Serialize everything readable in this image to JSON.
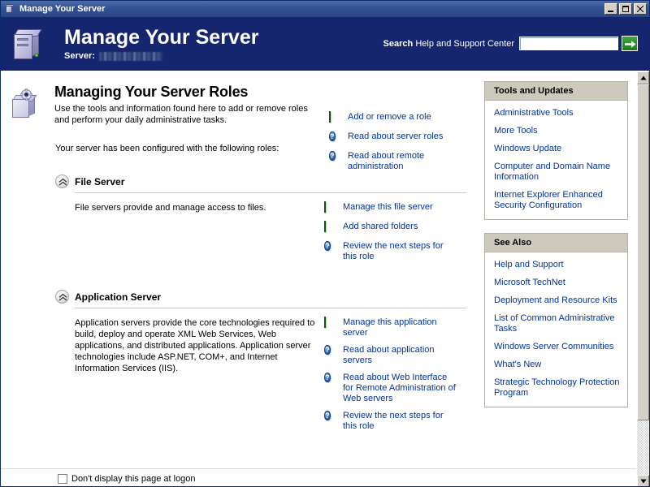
{
  "window": {
    "title": "Manage Your Server",
    "title_icon": "server-icon",
    "controls": {
      "minimize": "minimize-button",
      "maximize": "maximize-button",
      "close": "close-button"
    }
  },
  "header": {
    "icon": "server-tower-icon",
    "title": "Manage Your Server",
    "server_label": "Server:",
    "server_value": "",
    "search": {
      "label_bold": "Search",
      "label_rest": "Help and Support Center",
      "value": "",
      "placeholder": "",
      "go_icon": "arrow-right-icon",
      "go_label": "Go"
    }
  },
  "intro": {
    "icon": "server-gear-icon",
    "heading": "Managing Your Server Roles",
    "description": "Use the tools and information found here to add or remove roles and perform your daily administrative tasks.",
    "links": [
      {
        "icon": "green-arrow-icon",
        "label": "Add or remove a role"
      },
      {
        "icon": "help-icon",
        "label": "Read about server roles"
      },
      {
        "icon": "help-icon",
        "label": "Read about remote administration"
      }
    ],
    "configured_note": "Your server has been configured with the following roles:"
  },
  "roles": [
    {
      "collapse_icon": "chevron-up-icon",
      "title": "File Server",
      "description": "File servers provide and manage access to files.",
      "links": [
        {
          "icon": "green-arrow-icon",
          "label": "Manage this file server"
        },
        {
          "icon": "green-arrow-icon",
          "label": "Add shared folders"
        },
        {
          "icon": "help-icon",
          "label": "Review the next steps for this role"
        }
      ]
    },
    {
      "collapse_icon": "chevron-up-icon",
      "title": "Application Server",
      "description": "Application servers provide the core technologies required to build, deploy and operate XML Web Services, Web applications, and distributed applications. Application server technologies include ASP.NET, COM+, and Internet Information Services (IIS).",
      "links": [
        {
          "icon": "green-arrow-icon",
          "label": "Manage this application server"
        },
        {
          "icon": "help-icon",
          "label": "Read about application servers"
        },
        {
          "icon": "help-icon",
          "label": "Read about Web Interface for Remote Administration of Web servers"
        },
        {
          "icon": "help-icon",
          "label": "Review the next steps for this role"
        }
      ]
    }
  ],
  "sidebar": {
    "panels": [
      {
        "title": "Tools and Updates",
        "links": [
          "Administrative Tools",
          "More Tools",
          "Windows Update",
          "Computer and Domain Name Information",
          "Internet Explorer Enhanced Security Configuration"
        ]
      },
      {
        "title": "See Also",
        "links": [
          "Help and Support",
          "Microsoft TechNet",
          "Deployment and Resource Kits",
          "List of Common Administrative Tasks",
          "Windows Server Communities",
          "What's New",
          "Strategic Technology Protection Program"
        ]
      }
    ]
  },
  "footer": {
    "checkbox_label": "Don't display this page at logon",
    "checked": false
  },
  "scrollbar": {
    "up_icon": "triangle-up-icon",
    "down_icon": "triangle-down-icon"
  },
  "colors": {
    "titlebar": "#335292",
    "header_banner": "#16266e",
    "link": "#00339c",
    "panel_header": "#cdc9bd",
    "accent_green": "#1e7c1e",
    "help_blue": "#2f6fc4"
  }
}
